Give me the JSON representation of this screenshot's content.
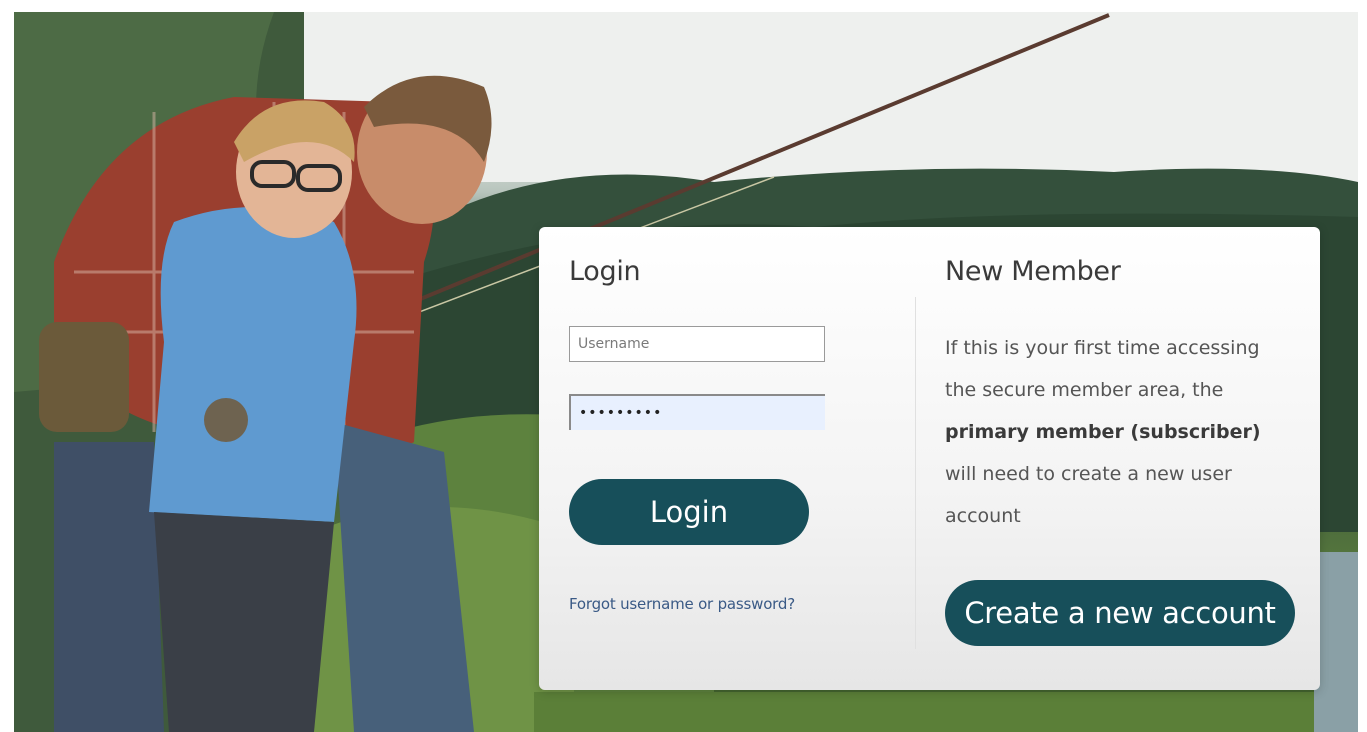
{
  "login": {
    "title": "Login",
    "username_placeholder": "Username",
    "password_value": "•••••••••",
    "button_label": "Login",
    "forgot_link": "Forgot username or password?"
  },
  "new_member": {
    "title": "New Member",
    "text_part1": "If this is your first time accessing the secure member area, the ",
    "text_bold": "primary member (subscriber)",
    "text_part2": " will need to create a new user account",
    "button_label": "Create a new account"
  },
  "colors": {
    "button": "#174f5a",
    "link": "#3a5a86",
    "password_field_bg": "#e8f0fe"
  }
}
